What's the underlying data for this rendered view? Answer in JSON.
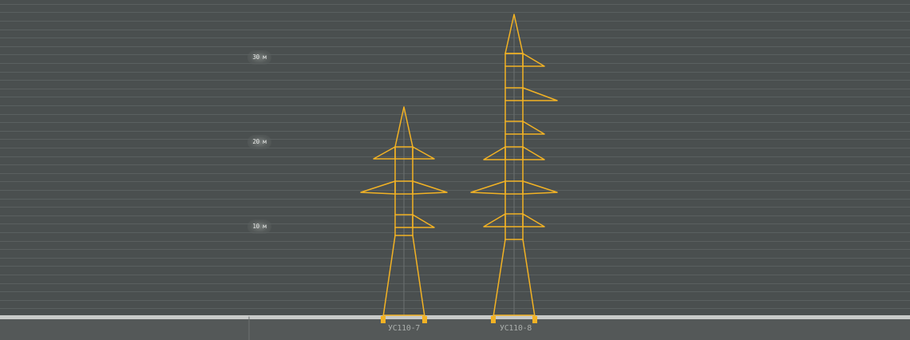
{
  "colors": {
    "background": "#4a4f4f",
    "gridline": "#5a6060",
    "tower": "#f2b224",
    "ground": "#c8cac8",
    "ground_bar": "#545858",
    "footing": "#f2b224"
  },
  "height_scale": {
    "unit": "м",
    "markers": [
      {
        "value": 30,
        "label": "30 м"
      },
      {
        "value": 20,
        "label": "20 м"
      },
      {
        "value": 10,
        "label": "10 м"
      }
    ]
  },
  "towers": [
    {
      "name": "УС110-7"
    },
    {
      "name": "УС110-8"
    }
  ]
}
